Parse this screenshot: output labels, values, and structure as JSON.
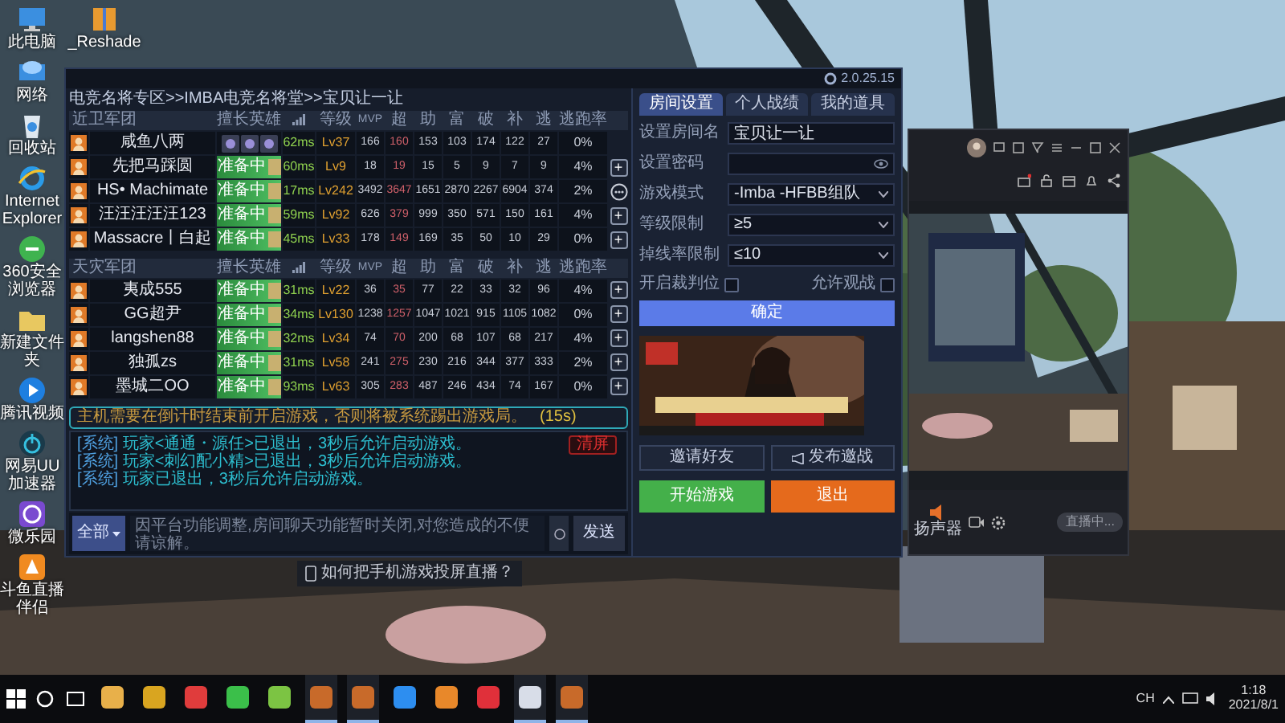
{
  "desktop_icons": [
    {
      "label": "此电脑"
    },
    {
      "label": "网络"
    },
    {
      "label": "回收站"
    },
    {
      "label": "Internet Explorer"
    },
    {
      "label": "360安全浏览器"
    },
    {
      "label": "新建文件夹"
    },
    {
      "label": "腾讯视频"
    },
    {
      "label": "网易UU加速器"
    },
    {
      "label": "微乐园"
    },
    {
      "label": "斗鱼直播伴侣"
    }
  ],
  "desktop_icon_second": {
    "label": "_Reshade"
  },
  "game_window": {
    "version": "2.0.25.15",
    "breadcrumb": "电竞名将专区>>IMBA电竞名将堂>>宝贝让一让",
    "teams": [
      {
        "name": "近卫军团",
        "columns": [
          "擅长英雄",
          "等级",
          "MVP",
          "超",
          "助",
          "富",
          "破",
          "补",
          "逃",
          "逃跑率"
        ],
        "players": [
          {
            "name": "咸鱼八两",
            "kind": "host",
            "ping": "62ms",
            "level": "Lv37",
            "stats": [
              "166",
              "160",
              "153",
              "103",
              "174",
              "122",
              "27"
            ],
            "rate": "0%"
          },
          {
            "name": "先把马踩圆",
            "kind": "player",
            "status": "准备中",
            "ping": "60ms",
            "level": "Lv9",
            "stats": [
              "18",
              "19",
              "15",
              "5",
              "9",
              "7",
              "9"
            ],
            "rate": "4%",
            "action": {
              "kind": "add",
              "label": "+"
            }
          },
          {
            "name": "HS• Machimate",
            "kind": "player",
            "status": "准备中",
            "ping": "17ms",
            "level": "Lv242",
            "stats": [
              "3492",
              "3647",
              "1651",
              "2870",
              "2267",
              "6904",
              "374"
            ],
            "rate": "2%",
            "action": {
              "kind": "chat"
            }
          },
          {
            "name": "汪汪汪汪汪123",
            "kind": "player",
            "status": "准备中",
            "ping": "59ms",
            "level": "Lv92",
            "stats": [
              "626",
              "379",
              "999",
              "350",
              "571",
              "150",
              "161"
            ],
            "rate": "4%",
            "action": {
              "kind": "add",
              "label": "+"
            }
          },
          {
            "name": "Massacre丨白起",
            "kind": "player",
            "status": "准备中",
            "ping": "45ms",
            "level": "Lv33",
            "stats": [
              "178",
              "149",
              "169",
              "35",
              "50",
              "10",
              "29"
            ],
            "rate": "0%",
            "action": {
              "kind": "add",
              "label": "+"
            }
          }
        ]
      },
      {
        "name": "天灾军团",
        "columns": [
          "擅长英雄",
          "等级",
          "MVP",
          "超",
          "助",
          "富",
          "破",
          "补",
          "逃",
          "逃跑率"
        ],
        "players": [
          {
            "name": "夷成555",
            "kind": "player",
            "status": "准备中",
            "ping": "31ms",
            "level": "Lv22",
            "stats": [
              "36",
              "35",
              "77",
              "22",
              "33",
              "32",
              "96"
            ],
            "rate": "4%",
            "action": {
              "kind": "add",
              "label": "+"
            }
          },
          {
            "name": "GG超尹",
            "kind": "player",
            "status": "准备中",
            "ping": "34ms",
            "level": "Lv130",
            "stats": [
              "1238",
              "1257",
              "1047",
              "1021",
              "915",
              "1105",
              "1082"
            ],
            "rate": "0%",
            "action": {
              "kind": "add",
              "label": "+"
            }
          },
          {
            "name": "langshen88",
            "kind": "player",
            "status": "准备中",
            "ping": "32ms",
            "level": "Lv34",
            "stats": [
              "74",
              "70",
              "200",
              "68",
              "107",
              "68",
              "217"
            ],
            "rate": "4%",
            "action": {
              "kind": "add",
              "label": "+"
            }
          },
          {
            "name": "独孤zs",
            "kind": "player",
            "status": "准备中",
            "ping": "31ms",
            "level": "Lv58",
            "stats": [
              "241",
              "275",
              "230",
              "216",
              "344",
              "377",
              "333"
            ],
            "rate": "2%",
            "action": {
              "kind": "add",
              "label": "+"
            }
          },
          {
            "name": "墨城二OO",
            "kind": "player",
            "status": "准备中",
            "ping": "93ms",
            "level": "Lv63",
            "stats": [
              "305",
              "283",
              "487",
              "246",
              "434",
              "74",
              "167"
            ],
            "rate": "0%",
            "action": {
              "kind": "add",
              "label": "+"
            }
          }
        ]
      }
    ],
    "notice": {
      "text": "主机需要在倒计时结束前开启游戏，否则将被系统踢出游戏局。",
      "countdown": "(15s)"
    },
    "chat": {
      "clear_button": "清屏",
      "messages": [
        {
          "tag": "[系统]",
          "text": "玩家<通通・源任>已退出，3秒后允许启动游戏。"
        },
        {
          "tag": "[系统]",
          "text": "玩家<刺幻配小精>已退出，3秒后允许启动游戏。"
        },
        {
          "tag": "[系统]",
          "text": "玩家已退出，3秒后允许启动游戏。"
        }
      ],
      "channel": "全部",
      "placeholder": "因平台功能调整,房间聊天功能暂时关闭,对您造成的不便请谅解。",
      "send": "发送"
    }
  },
  "room_panel": {
    "tabs": [
      {
        "label": "房间设置",
        "selected": true
      },
      {
        "label": "个人战绩",
        "selected": false
      },
      {
        "label": "我的道具",
        "selected": false
      }
    ],
    "fields": [
      {
        "label": "设置房间名",
        "kind": "text",
        "value": "宝贝让一让"
      },
      {
        "label": "设置密码",
        "kind": "password"
      },
      {
        "label": "游戏模式",
        "kind": "select",
        "value": "-Imba -HFBB组队"
      },
      {
        "label": "等级限制",
        "kind": "select",
        "value": "≥5"
      },
      {
        "label": "掉线率限制",
        "kind": "select",
        "value": "≤10"
      }
    ],
    "checkboxes": [
      {
        "label": "开启裁判位",
        "checked": false
      },
      {
        "label": "允许观战",
        "checked": false
      }
    ],
    "confirm": "确定",
    "invite": "邀请好友",
    "challenge": "发布邀战",
    "start": "开始游戏",
    "exit": "退出"
  },
  "stream_window": {
    "speaker": "扬声器",
    "live_button": "直播中..."
  },
  "tip": "如何把手机游戏投屏直播？",
  "taskbar": {
    "apps": [
      {
        "color": "#e8b04a",
        "active": false
      },
      {
        "color": "#d9a520",
        "active": false
      },
      {
        "color": "#e03c3c",
        "active": false
      },
      {
        "color": "#3bbf4a",
        "active": false
      },
      {
        "color": "#7cc443",
        "active": false
      },
      {
        "color": "#c86a2a",
        "active": true
      },
      {
        "color": "#c86a2a",
        "active": true
      },
      {
        "color": "#2d8ef0",
        "active": false
      },
      {
        "color": "#e8882a",
        "active": false
      },
      {
        "color": "#e0303a",
        "active": false
      },
      {
        "color": "#d8dde8",
        "active": true
      },
      {
        "color": "#c86a2a",
        "active": true
      }
    ],
    "ime": "CH",
    "time": "1:18",
    "date": "2021/8/1"
  }
}
